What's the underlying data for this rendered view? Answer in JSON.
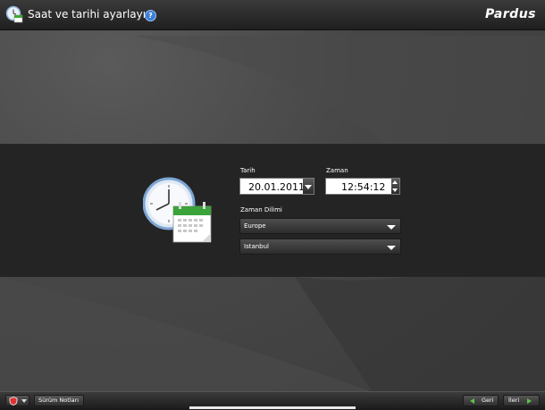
{
  "header": {
    "title": "Saat ve tarihi ayarlayın",
    "logo": "Pardus",
    "help": "?"
  },
  "form": {
    "date_label": "Tarih",
    "date_value": "20.01.2011",
    "time_label": "Zaman",
    "time_value": "12:54:12",
    "timezone_label": "Zaman Dilimi",
    "region_value": "Europe",
    "city_value": "Istanbul"
  },
  "footer": {
    "release_notes": "Sürüm Notları",
    "back": "Geri",
    "next": "İleri"
  },
  "colors": {
    "accent_green": "#5fc24a",
    "band": "#242424",
    "help_blue": "#3b7fd6"
  }
}
